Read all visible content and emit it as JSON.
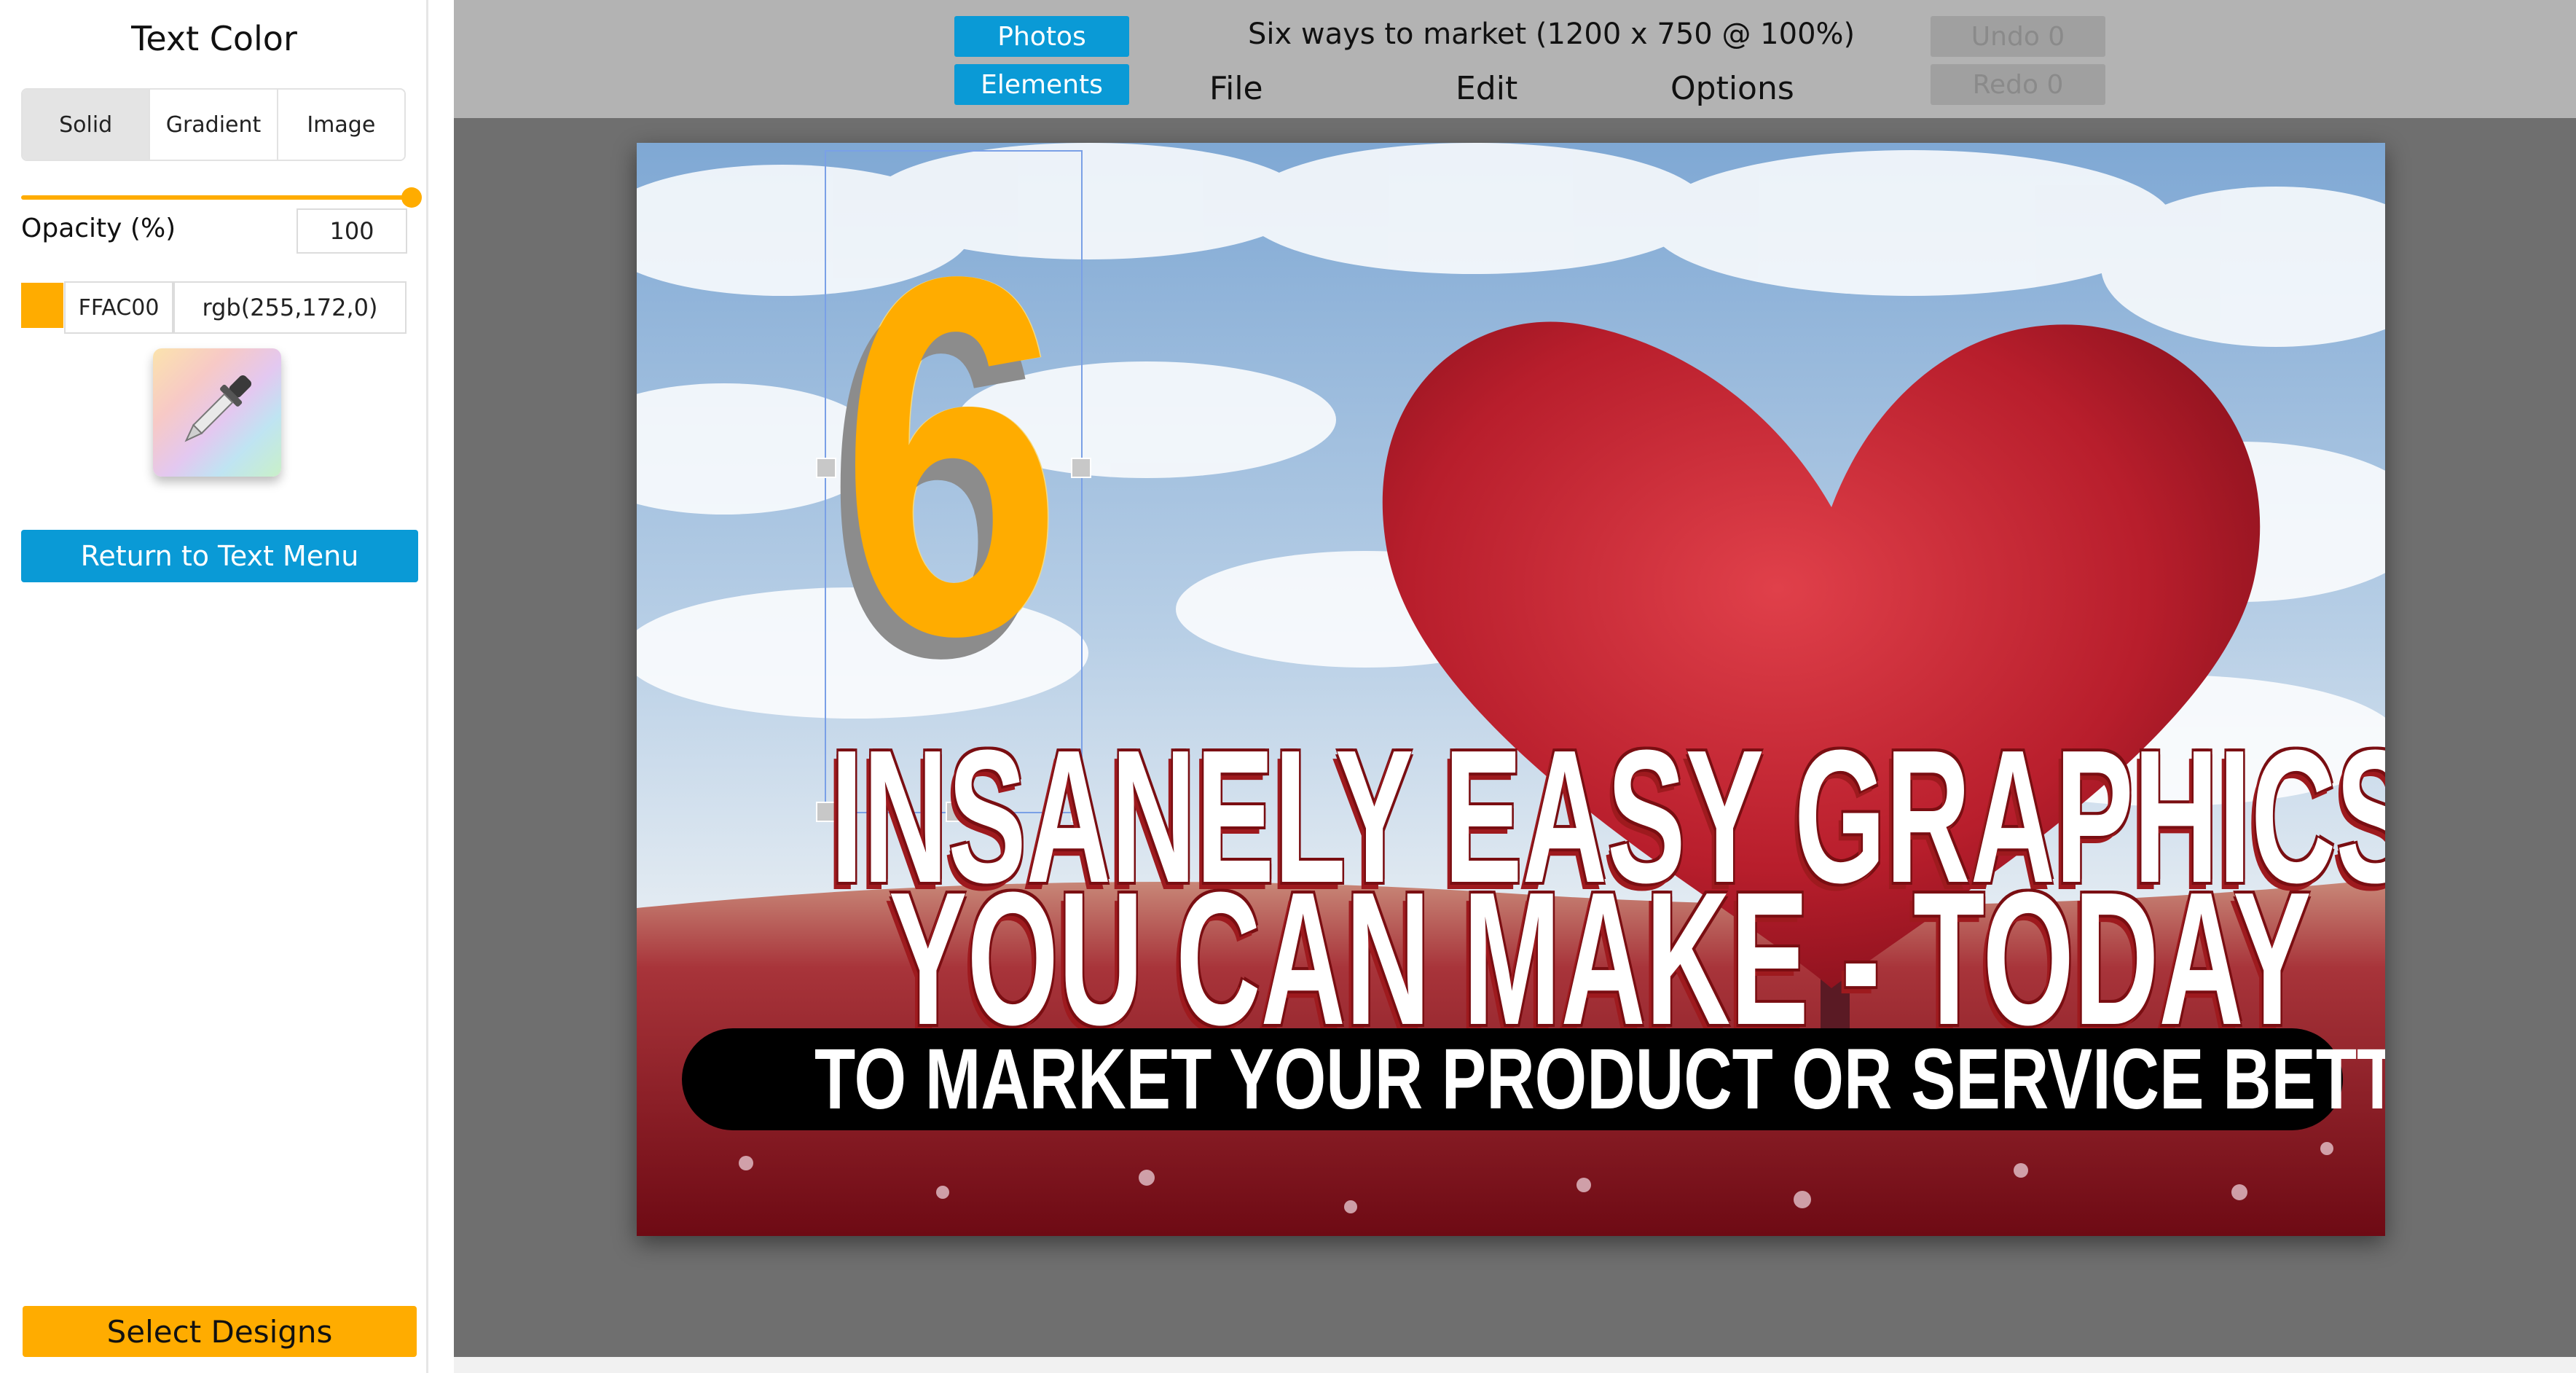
{
  "panel": {
    "title": "Text Color",
    "tabs": [
      {
        "label": "Solid",
        "active": true
      },
      {
        "label": "Gradient",
        "active": false
      },
      {
        "label": "Image",
        "active": false
      }
    ],
    "opacity_label": "Opacity (%)",
    "opacity_value": "100",
    "opacity_slider_fraction": 1.0,
    "swatch_color": "#FFAC00",
    "hex_value": "FFAC00",
    "rgb_value": "rgb(255,172,0)",
    "eyedropper_icon": "eyedropper-icon",
    "return_label": "Return to Text Menu",
    "select_designs_label": "Select Designs"
  },
  "toolbar": {
    "photos_label": "Photos",
    "elements_label": "Elements",
    "document_title": "Six ways to market (1200 x 750 @ 100%)",
    "menu": [
      "File",
      "Edit",
      "Options"
    ],
    "undo_label": "Undo 0",
    "redo_label": "Redo 0"
  },
  "canvas": {
    "big_number": "6",
    "headline_line1": "INSANELY EASY GRAPHICS",
    "headline_line2": "YOU CAN MAKE - TODAY",
    "tagline": "TO MARKET YOUR PRODUCT OR SERVICE BETTER"
  },
  "colors": {
    "accent_blue": "#0A9AD6",
    "accent_orange": "#FFAC00",
    "toolbar_gray": "#B3B3B3",
    "workspace_gray": "#6F6F6F"
  }
}
